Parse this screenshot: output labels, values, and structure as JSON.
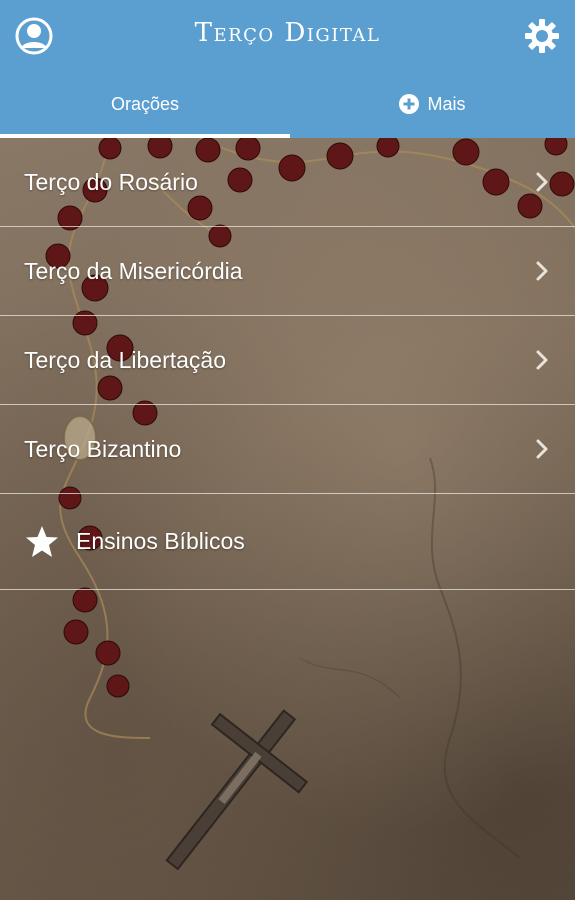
{
  "app": {
    "title": "Terço Digital"
  },
  "header": {
    "profile_icon": "user-circle-icon",
    "settings_icon": "gear-icon"
  },
  "tabs": [
    {
      "label": "Orações",
      "active": true
    },
    {
      "label": "Mais",
      "icon": "plus-circle-icon",
      "active": false
    }
  ],
  "menu": {
    "items": [
      {
        "label": "Terço do Rosário",
        "icon": "chevron-right-icon"
      },
      {
        "label": "Terço da Misericórdia",
        "icon": "chevron-right-icon"
      },
      {
        "label": "Terço da Libertação",
        "icon": "chevron-right-icon"
      },
      {
        "label": "Terço Bizantino",
        "icon": "chevron-right-icon"
      },
      {
        "label": "Ensinos Bíblicos",
        "icon": "star-icon"
      }
    ]
  },
  "colors": {
    "header_bg": "#5b9fd1",
    "text": "#ffffff"
  }
}
